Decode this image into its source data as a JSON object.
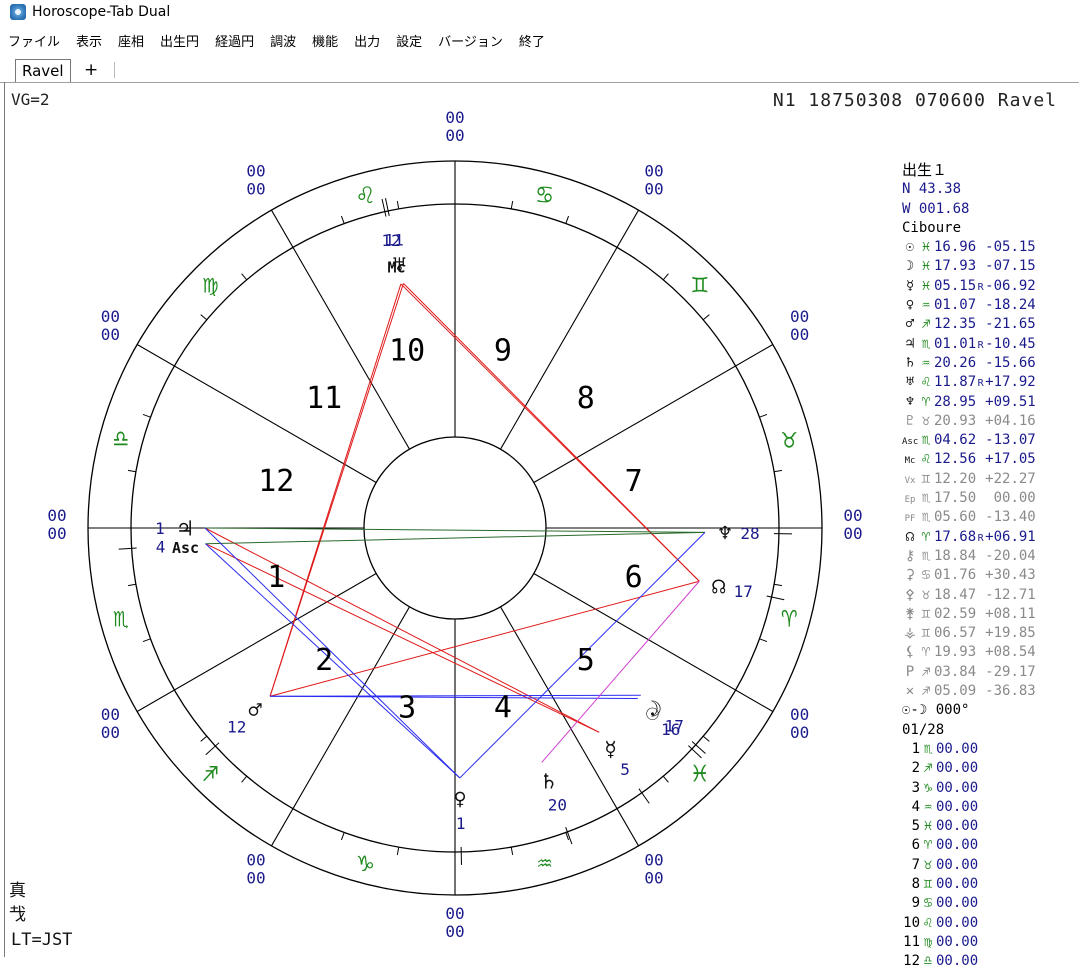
{
  "window": {
    "title": "Horoscope-Tab Dual"
  },
  "menu": [
    "ファイル",
    "表示",
    "座相",
    "出生円",
    "経過円",
    "調波",
    "機能",
    "出力",
    "設定",
    "バージョン",
    "終了"
  ],
  "tabs": [
    {
      "label": "Ravel"
    }
  ],
  "tab_add_label": "+",
  "header": {
    "vg": "VG=2",
    "info": "N1 18750308 070600  Ravel"
  },
  "bottom_left": [
    "真",
    "𢦏",
    "LT=JST"
  ],
  "colors": {
    "blue": "#1a1a8c",
    "green": "#1e8a1e",
    "gray": "#8a8a8a",
    "red": "#e01818",
    "aspect_blue": "#2a2af0",
    "aspect_green": "#2a6a2a",
    "aspect_magenta": "#d040d0"
  },
  "chart": {
    "zodiac_signs": [
      {
        "glyph": "♈",
        "name": "aries",
        "angle_deg": -15
      },
      {
        "glyph": "♉",
        "name": "taurus",
        "angle_deg": 15
      },
      {
        "glyph": "♊",
        "name": "gemini",
        "angle_deg": 45
      },
      {
        "glyph": "♋",
        "name": "cancer",
        "angle_deg": 75
      },
      {
        "glyph": "♌",
        "name": "leo",
        "angle_deg": 105
      },
      {
        "glyph": "♍",
        "name": "virgo",
        "angle_deg": 135
      },
      {
        "glyph": "♎",
        "name": "libra",
        "angle_deg": 165
      },
      {
        "glyph": "♏",
        "name": "scorpio",
        "angle_deg": 195
      },
      {
        "glyph": "♐",
        "name": "sagittarius",
        "angle_deg": 225
      },
      {
        "glyph": "♑",
        "name": "capricorn",
        "angle_deg": 255
      },
      {
        "glyph": "♒",
        "name": "aquarius",
        "angle_deg": 285
      },
      {
        "glyph": "♓",
        "name": "pisces",
        "angle_deg": 315
      }
    ],
    "house_numbers": [
      {
        "label": "1",
        "angle_deg": 195
      },
      {
        "label": "2",
        "angle_deg": 225
      },
      {
        "label": "3",
        "angle_deg": 255
      },
      {
        "label": "4",
        "angle_deg": 285
      },
      {
        "label": "5",
        "angle_deg": 315
      },
      {
        "label": "6",
        "angle_deg": 345
      },
      {
        "label": "7",
        "angle_deg": 15
      },
      {
        "label": "8",
        "angle_deg": 45
      },
      {
        "label": "9",
        "angle_deg": 75
      },
      {
        "label": "10",
        "angle_deg": 105
      },
      {
        "label": "11",
        "angle_deg": 135
      },
      {
        "label": "12",
        "angle_deg": 165
      }
    ],
    "cusp_labels": [
      {
        "text": "00",
        "angle_deg": 0
      },
      {
        "text": "00",
        "angle_deg": 30
      },
      {
        "text": "00",
        "angle_deg": 60
      },
      {
        "text": "00",
        "angle_deg": 90
      },
      {
        "text": "00",
        "angle_deg": 120
      },
      {
        "text": "00",
        "angle_deg": 150
      },
      {
        "text": "00",
        "angle_deg": 180
      },
      {
        "text": "00",
        "angle_deg": 210
      },
      {
        "text": "00",
        "angle_deg": 240
      },
      {
        "text": "00",
        "angle_deg": 270
      },
      {
        "text": "00",
        "angle_deg": 300
      },
      {
        "text": "00",
        "angle_deg": 330
      }
    ],
    "planets": [
      {
        "id": "uranus",
        "glyph": "♅",
        "deg": "11",
        "angle_deg": 101.9
      },
      {
        "id": "mc",
        "glyph": "Mc",
        "deg": "12",
        "angle_deg": 102.5
      },
      {
        "id": "jupiter",
        "glyph": "♃",
        "deg": "1",
        "angle_deg": 180.0
      },
      {
        "id": "asc",
        "glyph": "Asc",
        "deg": "4",
        "angle_deg": 183.6
      },
      {
        "id": "mars",
        "glyph": "♂",
        "deg": "12",
        "angle_deg": 222.3
      },
      {
        "id": "venus",
        "glyph": "♀",
        "deg": "1",
        "angle_deg": 271.1
      },
      {
        "id": "saturn",
        "glyph": "♄",
        "deg": "20",
        "angle_deg": 290.3
      },
      {
        "id": "mercury",
        "glyph": "☿",
        "deg": "5",
        "angle_deg": 305.2
      },
      {
        "id": "sun",
        "glyph": "☉",
        "deg": "16",
        "angle_deg": 317.0
      },
      {
        "id": "moon",
        "glyph": "☽",
        "deg": "17",
        "angle_deg": 318.0
      },
      {
        "id": "node",
        "glyph": "☊",
        "deg": "17",
        "angle_deg": 347.7
      },
      {
        "id": "neptune",
        "glyph": "♆",
        "deg": "28",
        "angle_deg": 359.0
      }
    ],
    "aspects": [
      {
        "from": "uranus",
        "to": "mars",
        "color": "red"
      },
      {
        "from": "mc",
        "to": "mars",
        "color": "red"
      },
      {
        "from": "uranus",
        "to": "node",
        "color": "red"
      },
      {
        "from": "mc",
        "to": "node",
        "color": "red"
      },
      {
        "from": "jupiter",
        "to": "mercury",
        "color": "red"
      },
      {
        "from": "asc",
        "to": "mercury",
        "color": "red"
      },
      {
        "from": "mars",
        "to": "node",
        "color": "red"
      },
      {
        "from": "jupiter",
        "to": "neptune",
        "color": "green"
      },
      {
        "from": "asc",
        "to": "neptune",
        "color": "green"
      },
      {
        "from": "jupiter",
        "to": "venus",
        "color": "blue"
      },
      {
        "from": "asc",
        "to": "venus",
        "color": "blue"
      },
      {
        "from": "mars",
        "to": "moon",
        "color": "blue"
      },
      {
        "from": "mars",
        "to": "sun",
        "color": "blue"
      },
      {
        "from": "venus",
        "to": "neptune",
        "color": "blue"
      },
      {
        "from": "saturn",
        "to": "node",
        "color": "magenta"
      }
    ]
  },
  "panel": {
    "title": "出生１",
    "lat": "N  43.38",
    "lon": "W 001.68",
    "place": "Ciboure",
    "rows": [
      {
        "g": "☉",
        "s": "♓",
        "v": "16.96",
        "r": "",
        "d": "-05.15",
        "c": "blue"
      },
      {
        "g": "☽",
        "s": "♓",
        "v": "17.93",
        "r": "",
        "d": "-07.15",
        "c": "blue"
      },
      {
        "g": "☿",
        "s": "♓",
        "v": "05.15",
        "r": "R",
        "d": "-06.92",
        "c": "blue"
      },
      {
        "g": "♀",
        "s": "♒",
        "v": "01.07",
        "r": "",
        "d": "-18.24",
        "c": "blue"
      },
      {
        "g": "♂",
        "s": "♐",
        "v": "12.35",
        "r": "",
        "d": "-21.65",
        "c": "blue"
      },
      {
        "g": "♃",
        "s": "♏",
        "v": "01.01",
        "r": "R",
        "d": "-10.45",
        "c": "blue"
      },
      {
        "g": "♄",
        "s": "♒",
        "v": "20.26",
        "r": "",
        "d": "-15.66",
        "c": "blue"
      },
      {
        "g": "♅",
        "s": "♌",
        "v": "11.87",
        "r": "R",
        "d": "+17.92",
        "c": "blue"
      },
      {
        "g": "♆",
        "s": "♈",
        "v": "28.95",
        "r": "",
        "d": "+09.51",
        "c": "blue"
      },
      {
        "g": "♇",
        "s": "♉",
        "v": "20.93",
        "r": "",
        "d": "+04.16",
        "c": "gray"
      },
      {
        "g": "Asc",
        "s": "♏",
        "v": "04.62",
        "r": "",
        "d": "-13.07",
        "c": "blue"
      },
      {
        "g": "Mc",
        "s": "♌",
        "v": "12.56",
        "r": "",
        "d": "+17.05",
        "c": "blue"
      },
      {
        "g": "Vx",
        "s": "♊",
        "v": "12.20",
        "r": "",
        "d": "+22.27",
        "c": "gray"
      },
      {
        "g": "Ep",
        "s": "♏",
        "v": "17.50",
        "r": "",
        "d": " 00.00",
        "c": "gray"
      },
      {
        "g": "PF",
        "s": "♏",
        "v": "05.60",
        "r": "",
        "d": "-13.40",
        "c": "gray"
      },
      {
        "g": "☊",
        "s": "♈",
        "v": "17.68",
        "r": "R",
        "d": "+06.91",
        "c": "blue"
      },
      {
        "g": "⚷",
        "s": "♏",
        "v": "18.84",
        "r": "",
        "d": "-20.04",
        "c": "gray"
      },
      {
        "g": "⚳",
        "s": "♋",
        "v": "01.76",
        "r": "",
        "d": "+30.43",
        "c": "gray"
      },
      {
        "g": "⚴",
        "s": "♉",
        "v": "18.47",
        "r": "",
        "d": "-12.71",
        "c": "gray"
      },
      {
        "g": "⚵",
        "s": "♊",
        "v": "02.59",
        "r": "",
        "d": "+08.11",
        "c": "gray"
      },
      {
        "g": "⚶",
        "s": "♊",
        "v": "06.57",
        "r": "",
        "d": "+19.85",
        "c": "gray"
      },
      {
        "g": "⚸",
        "s": "♈",
        "v": "19.93",
        "r": "",
        "d": "+08.54",
        "c": "gray"
      },
      {
        "g": "P",
        "s": "♐",
        "v": "03.84",
        "r": "",
        "d": "-29.17",
        "c": "gray"
      },
      {
        "g": "✕",
        "s": "♐",
        "v": "05.09",
        "r": "",
        "d": "-36.83",
        "c": "gray"
      }
    ],
    "sun_moon": "☉-☽  000°",
    "date": "01/28",
    "houses": [
      {
        "n": "1",
        "s": "♏",
        "v": "00.00"
      },
      {
        "n": "2",
        "s": "♐",
        "v": "00.00"
      },
      {
        "n": "3",
        "s": "♑",
        "v": "00.00"
      },
      {
        "n": "4",
        "s": "♒",
        "v": "00.00"
      },
      {
        "n": "5",
        "s": "♓",
        "v": "00.00"
      },
      {
        "n": "6",
        "s": "♈",
        "v": "00.00"
      },
      {
        "n": "7",
        "s": "♉",
        "v": "00.00"
      },
      {
        "n": "8",
        "s": "♊",
        "v": "00.00"
      },
      {
        "n": "9",
        "s": "♋",
        "v": "00.00"
      },
      {
        "n": "10",
        "s": "♌",
        "v": "00.00"
      },
      {
        "n": "11",
        "s": "♍",
        "v": "00.00"
      },
      {
        "n": "12",
        "s": "♎",
        "v": "00.00"
      }
    ]
  }
}
